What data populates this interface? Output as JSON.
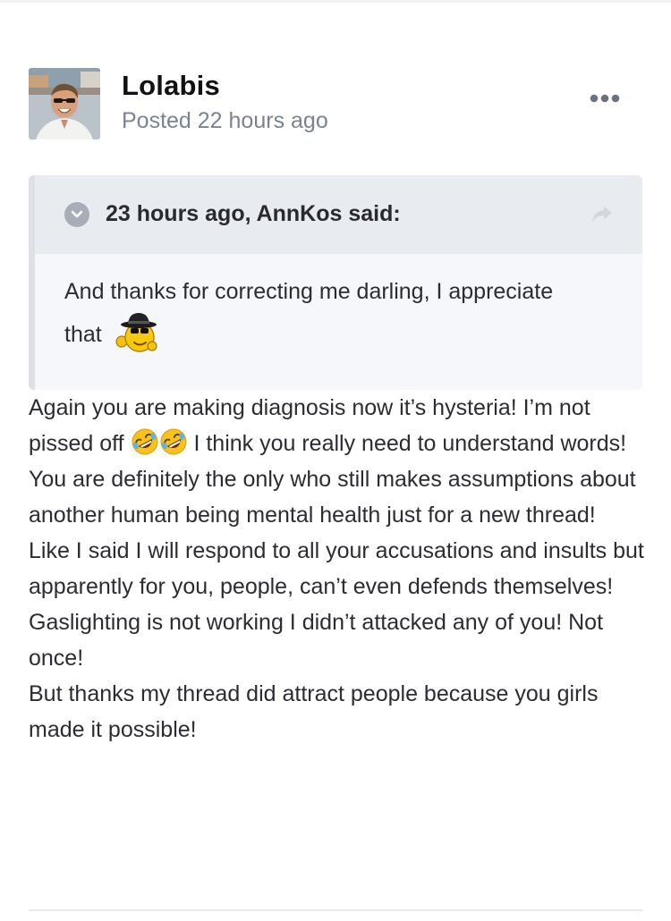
{
  "post": {
    "author": "Lolabis",
    "posted": "Posted 22 hours ago",
    "menu_icon": "ellipsis-icon"
  },
  "quote": {
    "citation": "23 hours ago, AnnKos said:",
    "line1": "And thanks for correcting me darling, I appreciate",
    "line2": "that",
    "toggle_icon": "chevron-down-icon",
    "share_icon": "share-arrow-icon",
    "emoji": "spy-smiley-emoji"
  },
  "content": {
    "p1_before": "Again you are making diagnosis now it’s hysteria! I’m not pissed off ",
    "p1_after": " I think you really need to understand words!",
    "p1_emoji": "rolling-on-floor-laughing-emoji",
    "p2": "You are definitely the only who still makes assumptions about another human being mental health just for a new thread!",
    "p3": "Like I said I will respond to all your accusations and insults but apparently for you,  people, can’t even defends themselves! Gaslighting is not working I didn’t attacked any of you! Not once!",
    "p4": "But thanks my thread did attract people because you girls made it possible!"
  },
  "colors": {
    "quote_background": "#f5f7fa",
    "quote_header": "#e8ebf0",
    "meta_text": "#7a8393"
  }
}
